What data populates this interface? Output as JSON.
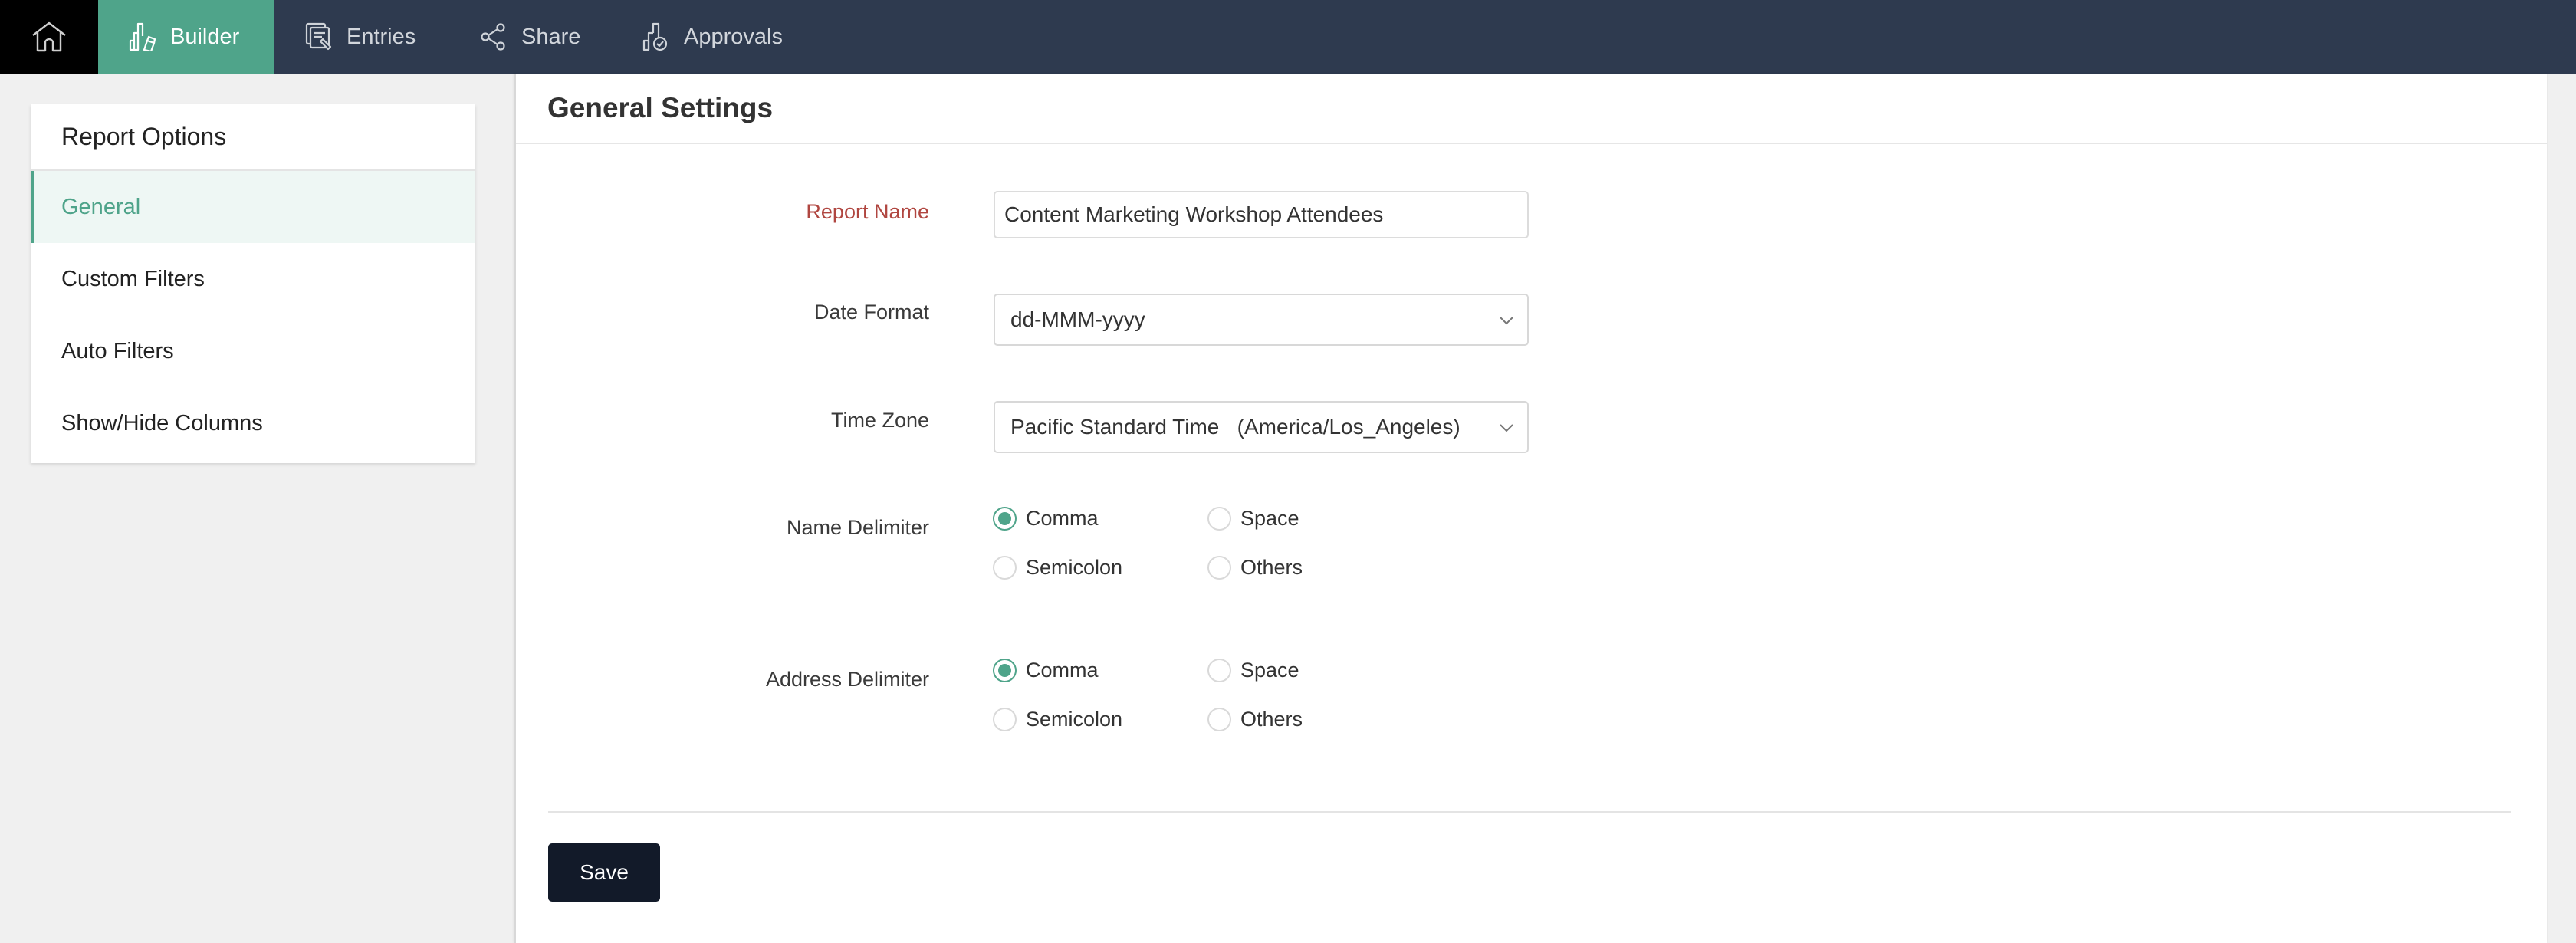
{
  "nav": {
    "home_icon": "home-icon",
    "tabs": [
      {
        "label": "Builder",
        "icon": "builder-icon",
        "active": true
      },
      {
        "label": "Entries",
        "icon": "entries-icon",
        "active": false
      },
      {
        "label": "Share",
        "icon": "share-icon",
        "active": false
      },
      {
        "label": "Approvals",
        "icon": "approvals-icon",
        "active": false
      }
    ]
  },
  "sidebar": {
    "title": "Report Options",
    "items": [
      {
        "label": "General",
        "active": true
      },
      {
        "label": "Custom Filters",
        "active": false
      },
      {
        "label": "Auto Filters",
        "active": false
      },
      {
        "label": "Show/Hide Columns",
        "active": false
      }
    ]
  },
  "main": {
    "title": "General Settings",
    "report_name": {
      "label": "Report Name",
      "value": "Content Marketing Workshop Attendees",
      "required": true
    },
    "date_format": {
      "label": "Date Format",
      "value": "dd-MMM-yyyy"
    },
    "time_zone": {
      "label": "Time Zone",
      "value": "Pacific Standard Time   (America/Los_Angeles)"
    },
    "name_delimiter": {
      "label": "Name Delimiter",
      "options": [
        "Comma",
        "Space",
        "Semicolon",
        "Others"
      ],
      "selected": "Comma"
    },
    "address_delimiter": {
      "label": "Address Delimiter",
      "options": [
        "Comma",
        "Space",
        "Semicolon",
        "Others"
      ],
      "selected": "Comma"
    },
    "save_label": "Save"
  },
  "colors": {
    "accent": "#4fa48a",
    "nav_bg": "#2e3a4f",
    "required_label": "#b04640",
    "button_bg": "#121a29"
  }
}
